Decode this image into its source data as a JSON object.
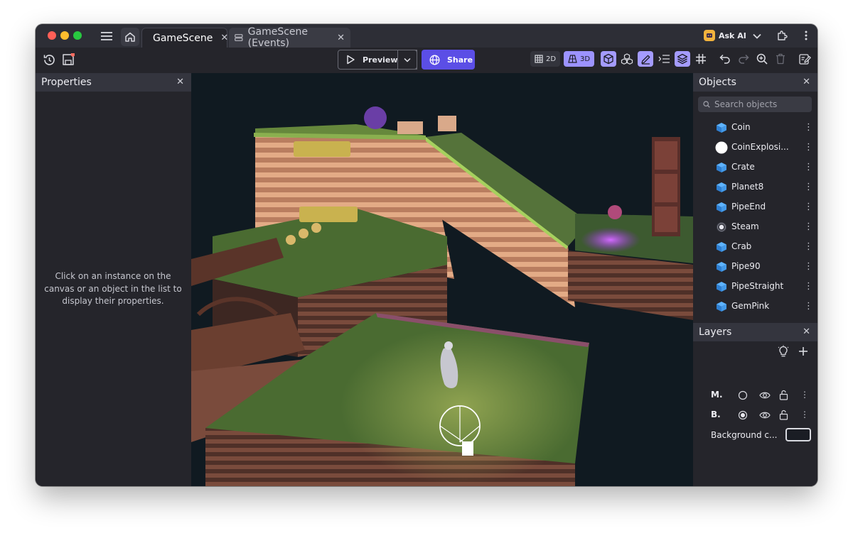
{
  "tabs": [
    {
      "label": "GameScene",
      "active": true
    },
    {
      "label": "GameScene (Events)",
      "active": false
    }
  ],
  "titlebar": {
    "ask_ai_label": "Ask AI"
  },
  "toolbar": {
    "preview_label": "Preview",
    "share_label": "Share",
    "view_2d_label": "2D",
    "view_3d_label": "3D",
    "active_view": "3D"
  },
  "properties": {
    "title": "Properties",
    "hint": "Click on an instance on the canvas or an object in the list to display their properties."
  },
  "objects": {
    "title": "Objects",
    "search_placeholder": "Search objects",
    "items": [
      {
        "name": "Coin",
        "icon": "model3d-icon"
      },
      {
        "name": "CoinExplosi...",
        "icon": "white-circle-icon"
      },
      {
        "name": "Crate",
        "icon": "model3d-icon"
      },
      {
        "name": "Planet8",
        "icon": "model3d-icon"
      },
      {
        "name": "PipeEnd",
        "icon": "model3d-icon"
      },
      {
        "name": "Steam",
        "icon": "particle-icon"
      },
      {
        "name": "Crab",
        "icon": "model3d-icon"
      },
      {
        "name": "Pipe90",
        "icon": "model3d-icon"
      },
      {
        "name": "PipeStraight",
        "icon": "model3d-icon"
      },
      {
        "name": "GemPink",
        "icon": "model3d-icon"
      }
    ]
  },
  "layers": {
    "title": "Layers",
    "items": [
      {
        "name": "M.",
        "selected": false
      },
      {
        "name": "B.",
        "selected": true
      }
    ],
    "background_label": "Background c..."
  },
  "colors": {
    "accent": "#5b4ee6",
    "toggle_active": "#a49bff",
    "window_bg": "#25252b",
    "panel_header": "#34353e"
  }
}
